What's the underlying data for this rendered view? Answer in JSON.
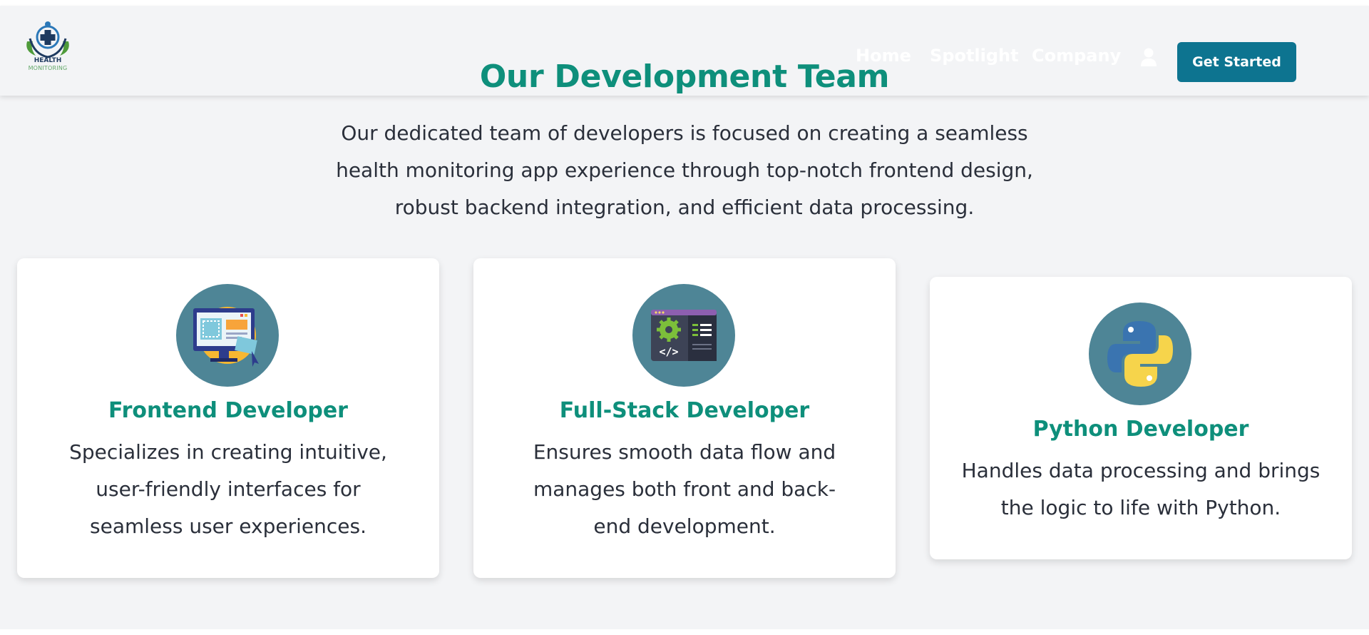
{
  "brand": {
    "logo_line1": "HEALTH",
    "logo_line2": "MONITORING"
  },
  "nav": {
    "links": [
      "Home",
      "Spotlight",
      "Company"
    ],
    "cta_label": "Get Started",
    "user_icon": "user-icon"
  },
  "section": {
    "title": "Our Development Team",
    "intro": "Our dedicated team of developers is focused on creating a seamless health monitoring app experience through top-notch frontend design, robust backend integration, and efficient data processing."
  },
  "cards": [
    {
      "icon": "desktop-computer-icon",
      "role": "Frontend Developer",
      "description": "Specializes in creating intuitive, user-friendly interfaces for seamless user experiences."
    },
    {
      "icon": "code-window-icon",
      "role": "Full-Stack Developer",
      "description": "Ensures smooth data flow and manages both front and back-end development."
    },
    {
      "icon": "python-logo-icon",
      "role": "Python Developer",
      "description": "Handles data processing and brings the logic to life with Python."
    }
  ],
  "colors": {
    "accent": "#0e8f7b",
    "cta": "#0d7490",
    "avatar_bg": "#4e8596",
    "page_bg": "#f3f4f6"
  }
}
